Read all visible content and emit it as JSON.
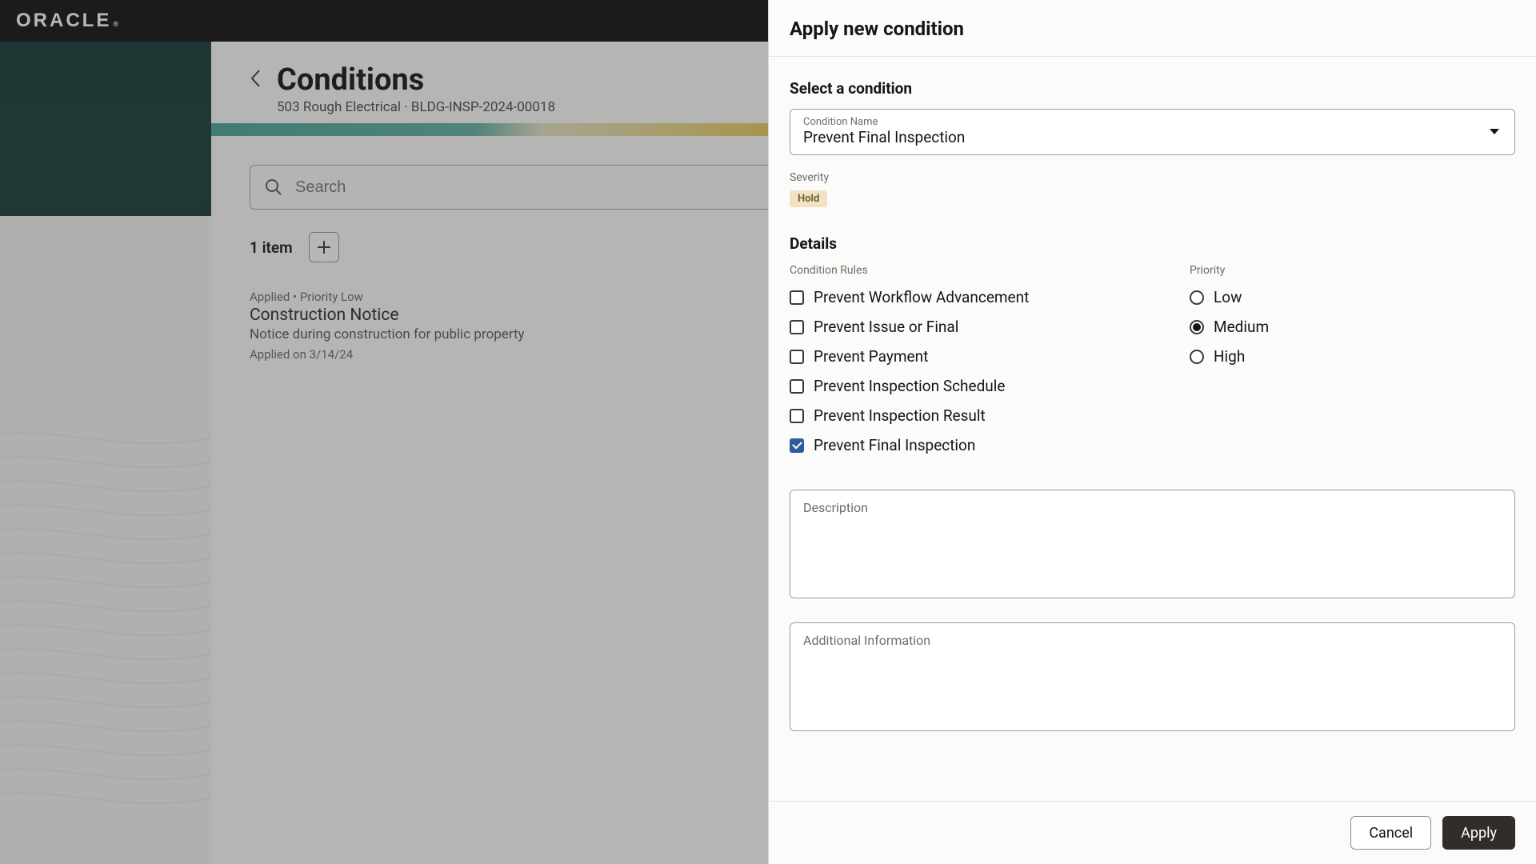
{
  "topbar": {
    "brand": "ORACLE"
  },
  "main": {
    "title": "Conditions",
    "subtitle": "503 Rough Electrical · BLDG-INSP-2024-00018",
    "search_placeholder": "Search",
    "item_count_label": "1 item",
    "item": {
      "meta": "Applied • Priority Low",
      "title": "Construction Notice",
      "desc": "Notice during construction for public property",
      "date": "Applied on 3/14/24"
    }
  },
  "drawer": {
    "title": "Apply new condition",
    "select_section": "Select a condition",
    "condition_name_label": "Condition Name",
    "condition_name_value": "Prevent Final Inspection",
    "severity_label": "Severity",
    "severity_value": "Hold",
    "details_section": "Details",
    "rules_label": "Condition Rules",
    "priority_label": "Priority",
    "rules": [
      {
        "label": "Prevent Workflow Advancement",
        "checked": false
      },
      {
        "label": "Prevent Issue or Final",
        "checked": false
      },
      {
        "label": "Prevent Payment",
        "checked": false
      },
      {
        "label": "Prevent Inspection Schedule",
        "checked": false
      },
      {
        "label": "Prevent Inspection Result",
        "checked": false
      },
      {
        "label": "Prevent Final Inspection",
        "checked": true
      }
    ],
    "priorities": [
      {
        "label": "Low",
        "checked": false
      },
      {
        "label": "Medium",
        "checked": true
      },
      {
        "label": "High",
        "checked": false
      }
    ],
    "description_label": "Description",
    "additional_label": "Additional Information",
    "cancel_label": "Cancel",
    "apply_label": "Apply"
  }
}
